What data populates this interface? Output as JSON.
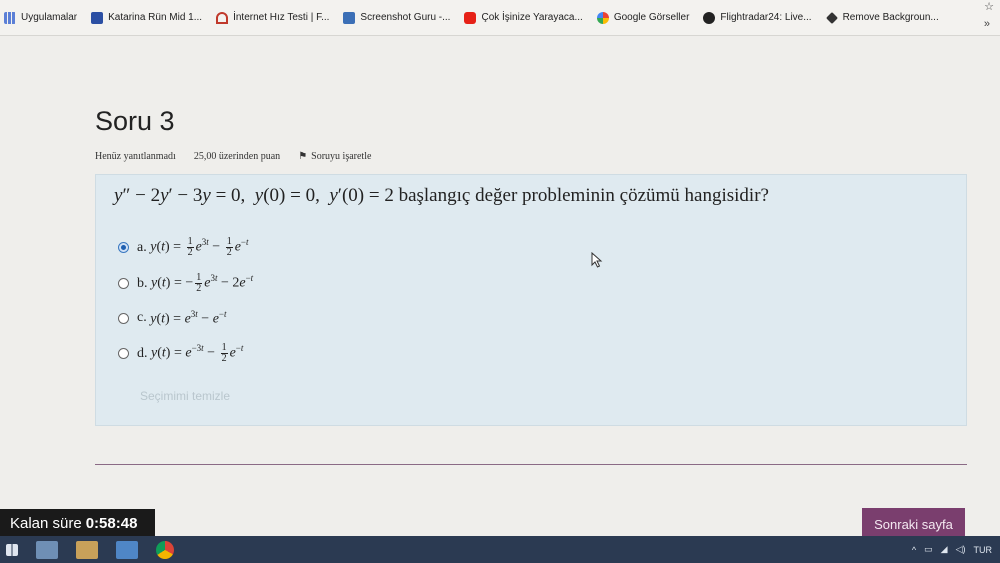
{
  "bookmarks": [
    {
      "label": "Uygulamalar",
      "icon": "apps-grid-icon",
      "color": "#5b7fd6"
    },
    {
      "label": "Katarina Rün Mid 1...",
      "icon": "bookmark-page-icon",
      "color": "#2b4fa3"
    },
    {
      "label": "İnternet Hız Testi | F...",
      "icon": "speedtest-icon",
      "color": "#c0392b"
    },
    {
      "label": "Screenshot Guru -...",
      "icon": "screenshot-guru-icon",
      "color": "#3b6fb6"
    },
    {
      "label": "Çok İşinize Yarayaca...",
      "icon": "youtube-icon",
      "color": "#e62117"
    },
    {
      "label": "Google Görseller",
      "icon": "google-icon",
      "color": "#4285f4"
    },
    {
      "label": "Flightradar24: Live...",
      "icon": "flightradar-icon",
      "color": "#222222"
    },
    {
      "label": "Remove Backgroun...",
      "icon": "remove-bg-icon",
      "color": "#333333"
    }
  ],
  "bookmarks_more": "»",
  "question": {
    "title": "Soru 3",
    "status": "Henüz yanıtlanmadı",
    "points": "25,00 üzerinden puan",
    "flag_label": "Soruyu işaretle",
    "text_suffix": "başlangıç değer probleminin çözümü hangisidir?",
    "clear_label": "Seçimimi temizle"
  },
  "options": [
    {
      "letter": "a.",
      "selected": true
    },
    {
      "letter": "b.",
      "selected": false
    },
    {
      "letter": "c.",
      "selected": false
    },
    {
      "letter": "d.",
      "selected": false
    }
  ],
  "timer": {
    "label": "Kalan süre",
    "value": "0:58:48"
  },
  "next_button": "Sonraki sayfa",
  "tray": {
    "language": "TUR"
  },
  "colors": {
    "accent": "#7a3e6e",
    "question_bg": "#dfeaf0",
    "taskbar": "#2b3a52"
  }
}
